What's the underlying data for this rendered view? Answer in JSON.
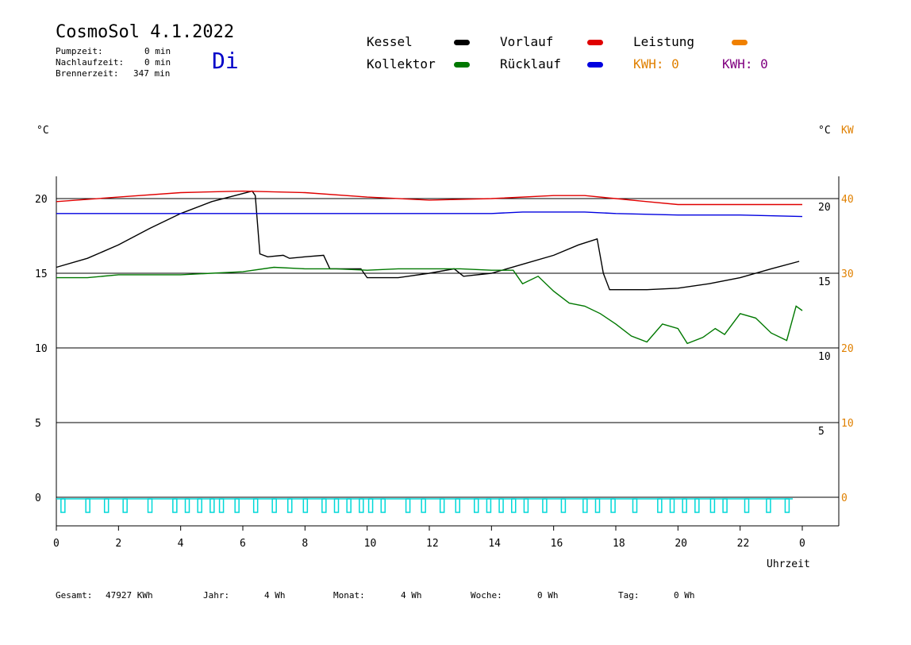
{
  "header": {
    "title": "CosmoSol 4.1.2022",
    "day": "Di",
    "stats": [
      {
        "label": "Pumpzeit:",
        "value": "0 min"
      },
      {
        "label": "Nachlaufzeit:",
        "value": "0 min"
      },
      {
        "label": "Brennerzeit:",
        "value": "347 min"
      }
    ]
  },
  "legend": {
    "kessel": "Kessel",
    "kollektor": "Kollektor",
    "vorlauf": "Vorlauf",
    "ruecklauf": "Rücklauf",
    "leistung": "Leistung",
    "kwh1": "KWH: 0",
    "kwh2": "KWH: 0"
  },
  "colors": {
    "kessel": "#000000",
    "kollektor": "#007800",
    "vorlauf": "#e00000",
    "ruecklauf": "#0000e0",
    "leistung": "#f08000",
    "kwh2": "#800080",
    "pump": "#00d8d8"
  },
  "footer": {
    "gesamt_label": "Gesamt:",
    "gesamt_value": "47927 KWh",
    "jahr_label": "Jahr:",
    "jahr_value": "4 Wh",
    "monat_label": "Monat:",
    "monat_value": "4 Wh",
    "woche_label": "Woche:",
    "woche_value": "0 Wh",
    "tag_label": "Tag:",
    "tag_value": "0 Wh"
  },
  "chart_data": {
    "type": "line",
    "xlabel": "Uhrzeit",
    "ylabel_left": "°C",
    "ylabel_right": "°C",
    "ylabel_right2": "KW",
    "xlim": [
      0,
      24
    ],
    "x_ticks": [
      "0",
      "2",
      "4",
      "6",
      "8",
      "10",
      "12",
      "14",
      "16",
      "18",
      "20",
      "22",
      "0"
    ],
    "left_axis": {
      "ylim": [
        0,
        20
      ],
      "ticks": [
        "0",
        "5",
        "10",
        "15",
        "20"
      ]
    },
    "right_axis_c": {
      "ticks": [
        "5",
        "10",
        "15",
        "20"
      ]
    },
    "right_axis_kw": {
      "ticks": [
        "0",
        "10",
        "20",
        "30",
        "40"
      ]
    },
    "series": [
      {
        "name": "Kessel",
        "color_key": "kessel",
        "points": [
          [
            0,
            15.4
          ],
          [
            1,
            16.0
          ],
          [
            2,
            16.9
          ],
          [
            3,
            18.0
          ],
          [
            4,
            19.0
          ],
          [
            5,
            19.8
          ],
          [
            6.3,
            20.5
          ],
          [
            6.4,
            20.2
          ],
          [
            6.55,
            16.3
          ],
          [
            6.8,
            16.1
          ],
          [
            7.3,
            16.2
          ],
          [
            7.5,
            16.0
          ],
          [
            8,
            16.1
          ],
          [
            8.6,
            16.2
          ],
          [
            8.8,
            15.3
          ],
          [
            9.8,
            15.3
          ],
          [
            10,
            14.7
          ],
          [
            10.5,
            14.7
          ],
          [
            11,
            14.7
          ],
          [
            12,
            15.0
          ],
          [
            12.8,
            15.3
          ],
          [
            13.1,
            14.8
          ],
          [
            14,
            15.0
          ],
          [
            15,
            15.6
          ],
          [
            16,
            16.2
          ],
          [
            16.8,
            16.9
          ],
          [
            17.4,
            17.3
          ],
          [
            17.6,
            15.0
          ],
          [
            17.8,
            13.9
          ],
          [
            19,
            13.9
          ],
          [
            20,
            14.0
          ],
          [
            21,
            14.3
          ],
          [
            22,
            14.7
          ],
          [
            23,
            15.3
          ],
          [
            23.9,
            15.8
          ]
        ]
      },
      {
        "name": "Kollektor",
        "color_key": "kollektor",
        "points": [
          [
            0,
            14.7
          ],
          [
            1,
            14.7
          ],
          [
            2,
            14.9
          ],
          [
            3,
            14.9
          ],
          [
            4,
            14.9
          ],
          [
            5,
            15.0
          ],
          [
            6,
            15.1
          ],
          [
            7,
            15.4
          ],
          [
            8,
            15.3
          ],
          [
            9,
            15.3
          ],
          [
            10,
            15.2
          ],
          [
            11,
            15.3
          ],
          [
            12,
            15.3
          ],
          [
            13,
            15.3
          ],
          [
            14,
            15.2
          ],
          [
            14.7,
            15.2
          ],
          [
            15,
            14.3
          ],
          [
            15.5,
            14.8
          ],
          [
            16,
            13.8
          ],
          [
            16.5,
            13.0
          ],
          [
            17,
            12.8
          ],
          [
            17.5,
            12.3
          ],
          [
            18,
            11.6
          ],
          [
            18.5,
            10.8
          ],
          [
            19,
            10.4
          ],
          [
            19.5,
            11.6
          ],
          [
            20,
            11.3
          ],
          [
            20.3,
            10.3
          ],
          [
            20.8,
            10.7
          ],
          [
            21.2,
            11.3
          ],
          [
            21.5,
            10.9
          ],
          [
            22,
            12.3
          ],
          [
            22.5,
            12.0
          ],
          [
            23,
            11.0
          ],
          [
            23.5,
            10.5
          ],
          [
            23.8,
            12.8
          ],
          [
            24,
            12.5
          ]
        ]
      },
      {
        "name": "Vorlauf",
        "color_key": "vorlauf",
        "points": [
          [
            0,
            19.8
          ],
          [
            2,
            20.1
          ],
          [
            4,
            20.4
          ],
          [
            6,
            20.5
          ],
          [
            8,
            20.4
          ],
          [
            10,
            20.1
          ],
          [
            12,
            19.9
          ],
          [
            14,
            20.0
          ],
          [
            16,
            20.2
          ],
          [
            17,
            20.2
          ],
          [
            18,
            20.0
          ],
          [
            19,
            19.8
          ],
          [
            20,
            19.6
          ],
          [
            22,
            19.6
          ],
          [
            24,
            19.6
          ]
        ]
      },
      {
        "name": "Rücklauf",
        "color_key": "ruecklauf",
        "points": [
          [
            0,
            19.0
          ],
          [
            6,
            19.0
          ],
          [
            8,
            19.0
          ],
          [
            10,
            19.0
          ],
          [
            12,
            19.0
          ],
          [
            14,
            19.0
          ],
          [
            15,
            19.1
          ],
          [
            17,
            19.1
          ],
          [
            18,
            19.0
          ],
          [
            20,
            18.9
          ],
          [
            22,
            18.9
          ],
          [
            24,
            18.8
          ]
        ]
      }
    ],
    "pump_pulses_hours": [
      0.2,
      1.0,
      1.6,
      2.2,
      3.0,
      3.8,
      4.2,
      4.6,
      5.0,
      5.3,
      5.8,
      6.4,
      7.0,
      7.5,
      8.0,
      8.6,
      9.0,
      9.4,
      9.8,
      10.1,
      10.5,
      11.3,
      11.8,
      12.4,
      12.9,
      13.5,
      13.9,
      14.3,
      14.7,
      15.1,
      15.7,
      16.3,
      17.0,
      17.4,
      17.9,
      18.6,
      19.4,
      19.8,
      20.2,
      20.6,
      21.1,
      21.5,
      22.2,
      22.9,
      23.5
    ]
  }
}
